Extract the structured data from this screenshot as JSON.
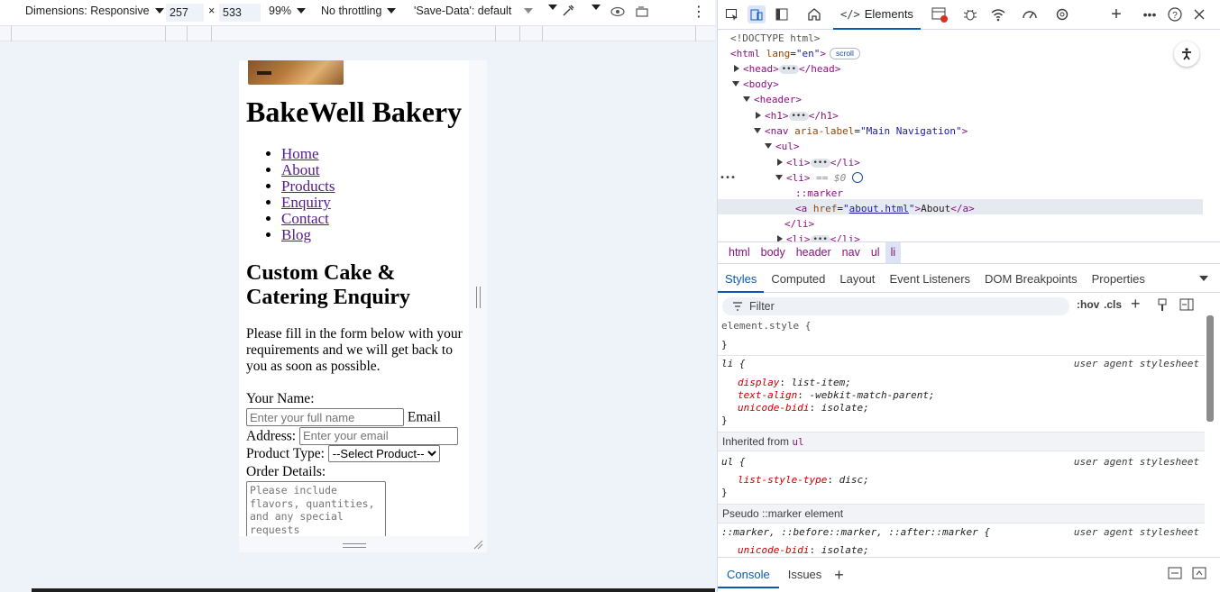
{
  "device_toolbar": {
    "dimensions_label": "Dimensions: Responsive",
    "width": "257",
    "times": "×",
    "height": "533",
    "zoom": "99%",
    "throttling": "No throttling",
    "save_data": "'Save-Data': default",
    "more_icon": "⋮"
  },
  "site": {
    "title": "BakeWell Bakery",
    "nav": [
      "Home",
      "About",
      "Products",
      "Enquiry",
      "Contact",
      "Blog"
    ],
    "heading": "Custom Cake & Catering Enquiry",
    "intro": "Please fill in the form below with your requirements and we will get back to you as soon as possible.",
    "form": {
      "name_label": "Your Name:",
      "name_placeholder": "Enter your full name",
      "email_label_1": "Email",
      "email_label_2": "Address:",
      "email_placeholder": "Enter your email",
      "product_label": "Product Type:",
      "product_selected": "--Select Product--",
      "details_label": "Order Details:",
      "details_placeholder": "Please include flavors, quantities, and any special requests"
    }
  },
  "devtools": {
    "tabs": {
      "elements": "Elements"
    },
    "dom": {
      "doctype": "<!DOCTYPE html>",
      "html_open": "<html",
      "lang_attr": "lang",
      "lang_val": "\"en\"",
      "scroll_badge": "scroll",
      "head": "<head>",
      "head_close": "</head>",
      "body": "<body>",
      "header": "<header>",
      "h1": "<h1>",
      "h1_close": "</h1>",
      "nav_open": "<nav",
      "nav_attr": "aria-label",
      "nav_val": "\"Main Navigation\"",
      "ul": "<ul>",
      "li": "<li>",
      "li_close": "</li>",
      "dollar0": "== $0",
      "marker": "::marker",
      "a_open": "<a",
      "href_attr": "href",
      "href_val": "about.html",
      "a_text": "About",
      "a_close": "</a>",
      "row_dots": "•••"
    },
    "breadcrumbs": [
      "html",
      "body",
      "header",
      "nav",
      "ul",
      "li"
    ],
    "subtabs": [
      "Styles",
      "Computed",
      "Layout",
      "Event Listeners",
      "DOM Breakpoints",
      "Properties"
    ],
    "filter_placeholder": "Filter",
    "filter_tools": [
      ":hov",
      ".cls",
      "+"
    ],
    "styles": {
      "element_style": "element.style {",
      "close_brace": "}",
      "li_selector": "li {",
      "ua_label": "user agent stylesheet",
      "li_props": [
        {
          "name": "display",
          "value": "list-item;"
        },
        {
          "name": "text-align",
          "value": "-webkit-match-parent;"
        },
        {
          "name": "unicode-bidi",
          "value": "isolate;"
        }
      ],
      "inherited_label": "Inherited from",
      "inherited_tag": "ul",
      "ul_selector": "ul {",
      "ul_props": [
        {
          "name": "list-style-type",
          "value": "disc;"
        }
      ],
      "pseudo_label": "Pseudo ::marker element",
      "marker_selector": "::marker, ::before::marker, ::after::marker {",
      "marker_props": [
        {
          "name": "unicode-bidi",
          "value": "isolate;"
        }
      ]
    },
    "drawer_tabs": [
      "Console",
      "Issues"
    ],
    "drawer_add": "+"
  }
}
